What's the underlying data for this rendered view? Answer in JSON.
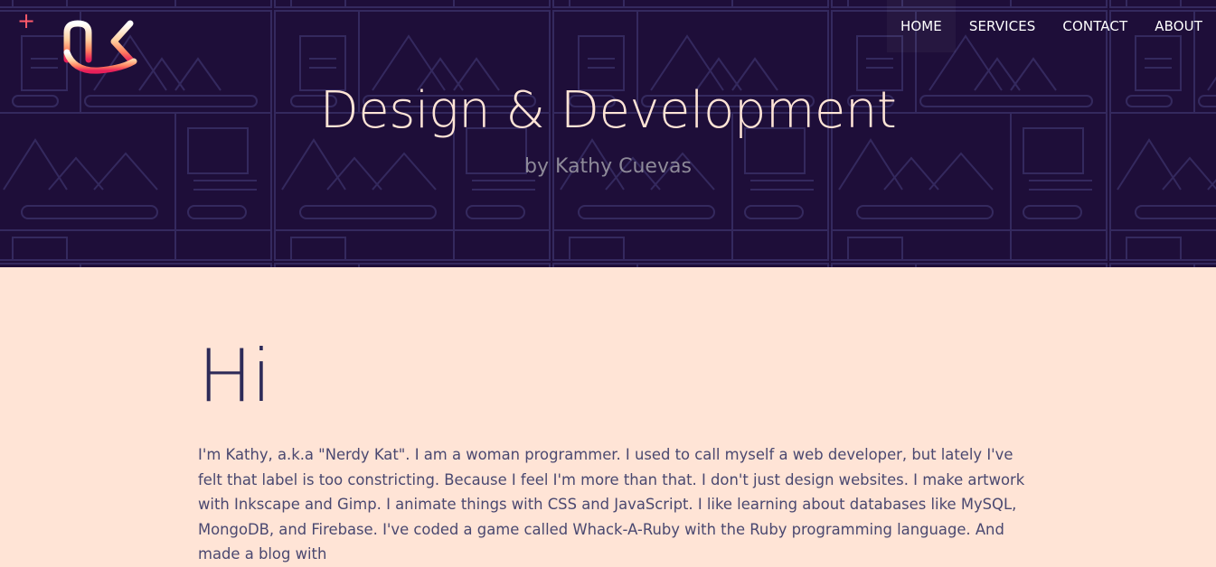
{
  "header": {
    "menu_icon": "plus-icon",
    "logo_text": "nk",
    "nav": [
      {
        "label": "HOME"
      },
      {
        "label": "SERVICES"
      },
      {
        "label": "CONTACT"
      },
      {
        "label": "ABOUT"
      }
    ]
  },
  "hero": {
    "title": "Design & Development",
    "subtitle": "by Kathy Cuevas"
  },
  "main": {
    "greeting": "Hi",
    "intro": "I'm Kathy, a.k.a \"Nerdy Kat\". I am a woman programmer. I used to call myself a web developer, but lately I've felt that label is too constricting. Because I feel I'm more than that. I don't just design websites. I make artwork with Inkscape and Gimp. I animate things with CSS and JavaScript. I like learning about databases like MySQL, MongoDB, and Firebase. I've coded a game called Whack-A-Ruby with the Ruby programming language. And made a blog with"
  },
  "colors": {
    "hero_bg": "#1e0e39",
    "page_bg": "#ffe4d6",
    "accent": "#ff5a6a",
    "heading": "#2d2a58"
  }
}
